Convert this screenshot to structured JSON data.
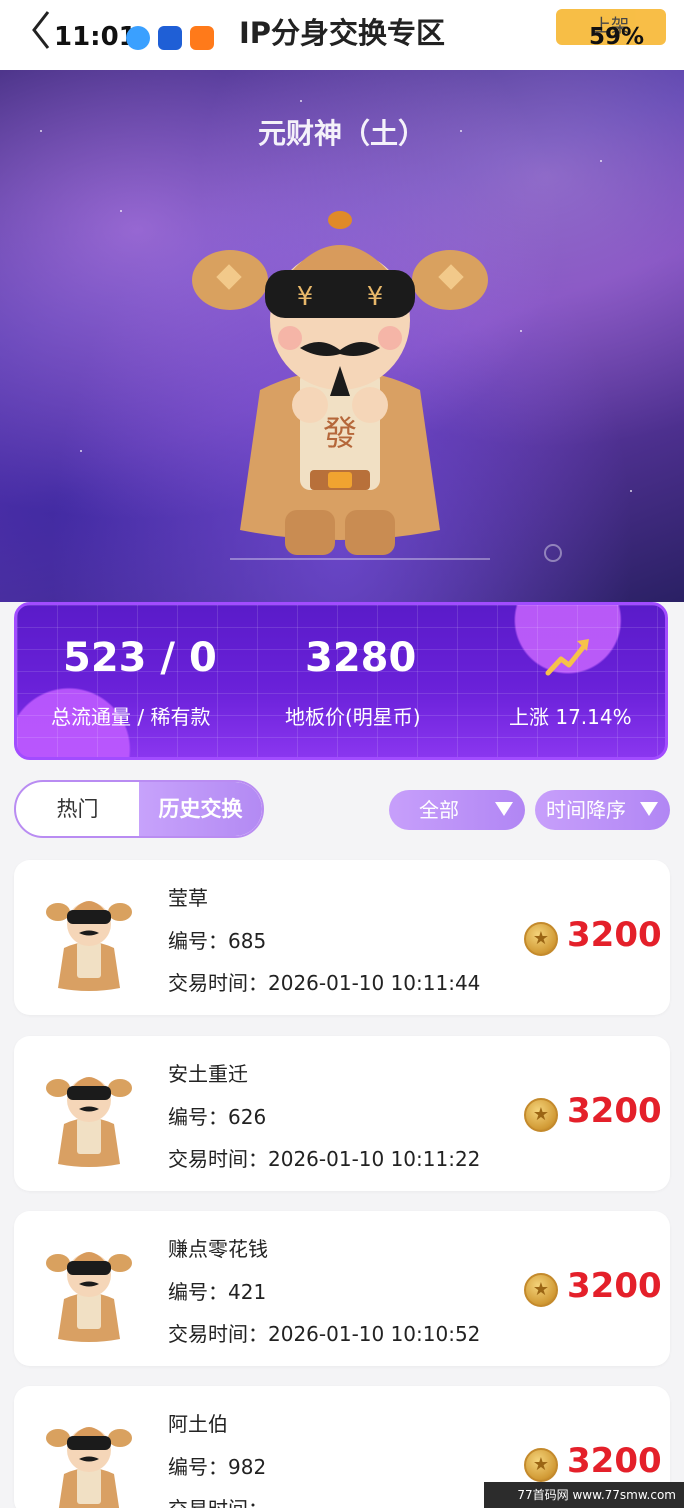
{
  "status_bar": {
    "time": "11:01",
    "battery": "59%"
  },
  "header": {
    "title": "IP分身交换专区",
    "list_button": "上架"
  },
  "hero": {
    "name": "元财神（土）"
  },
  "stats": {
    "total_rare": "523 / 0",
    "total_rare_label": "总流通量 / 稀有款",
    "floor_price": "3280",
    "floor_price_label": "地板价(明星币)",
    "change_label": "上涨 17.14%"
  },
  "tabs": [
    {
      "label": "热门",
      "active": false
    },
    {
      "label": "历史交换",
      "active": true
    }
  ],
  "filters": {
    "category": "全部",
    "sort": "时间降序"
  },
  "trades": [
    {
      "name": "莹草",
      "number": "编号：685",
      "time": "交易时间：2026-01-10 10:11:44",
      "price": "3200"
    },
    {
      "name": "安土重迁",
      "number": "编号：626",
      "time": "交易时间：2026-01-10 10:11:22",
      "price": "3200"
    },
    {
      "name": "赚点零花钱",
      "number": "编号：421",
      "time": "交易时间：2026-01-10 10:10:52",
      "price": "3200"
    },
    {
      "name": "阿土伯",
      "number": "编号：982",
      "time": "交易时间：",
      "price": "3200"
    }
  ],
  "watermark": "77首码网 www.77smw.com",
  "colors": {
    "accent": "#a24cff",
    "price": "#e4202a",
    "filter": "#b98cf2"
  }
}
